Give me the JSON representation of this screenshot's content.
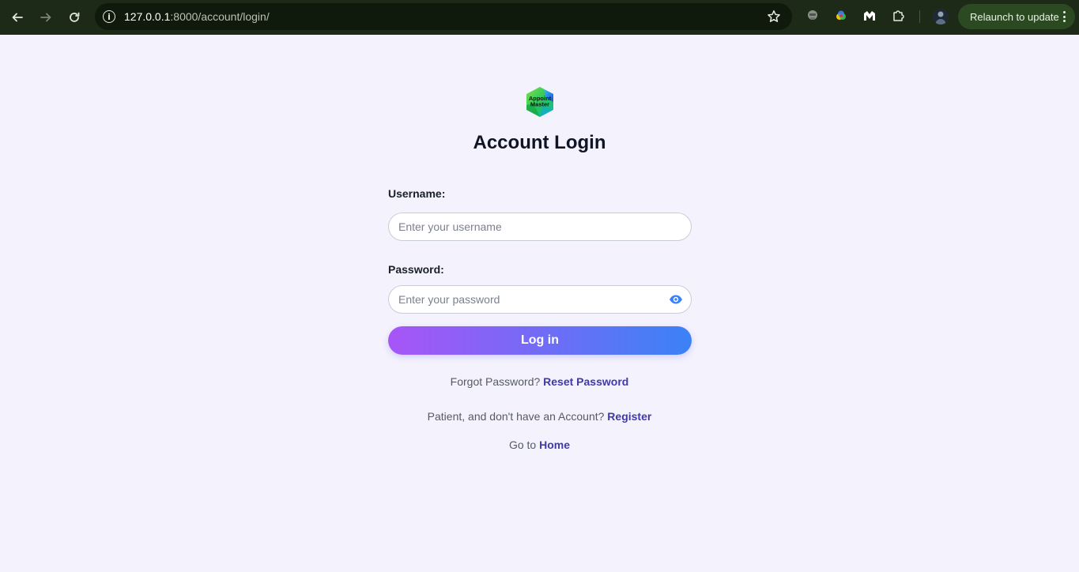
{
  "browser": {
    "url_host": "127.0.0.1",
    "url_path": ":8000/account/login/",
    "relaunch_label": "Relaunch to update"
  },
  "page": {
    "logo_text_1": "Appoint",
    "logo_text_2": "Master",
    "title": "Account Login",
    "username_label": "Username:",
    "username_placeholder": "Enter your username",
    "password_label": "Password:",
    "password_placeholder": "Enter your password",
    "login_button": "Log in",
    "forgot_text": "Forgot Password?",
    "reset_link": "Reset Password",
    "register_text": "Patient, and don't have an Account?",
    "register_link": "Register",
    "home_text": "Go to",
    "home_link": "Home"
  },
  "colors": {
    "accent_start": "#a855f7",
    "accent_end": "#3b82f6",
    "link": "#3f3aa8",
    "background": "#f4f2fd"
  }
}
